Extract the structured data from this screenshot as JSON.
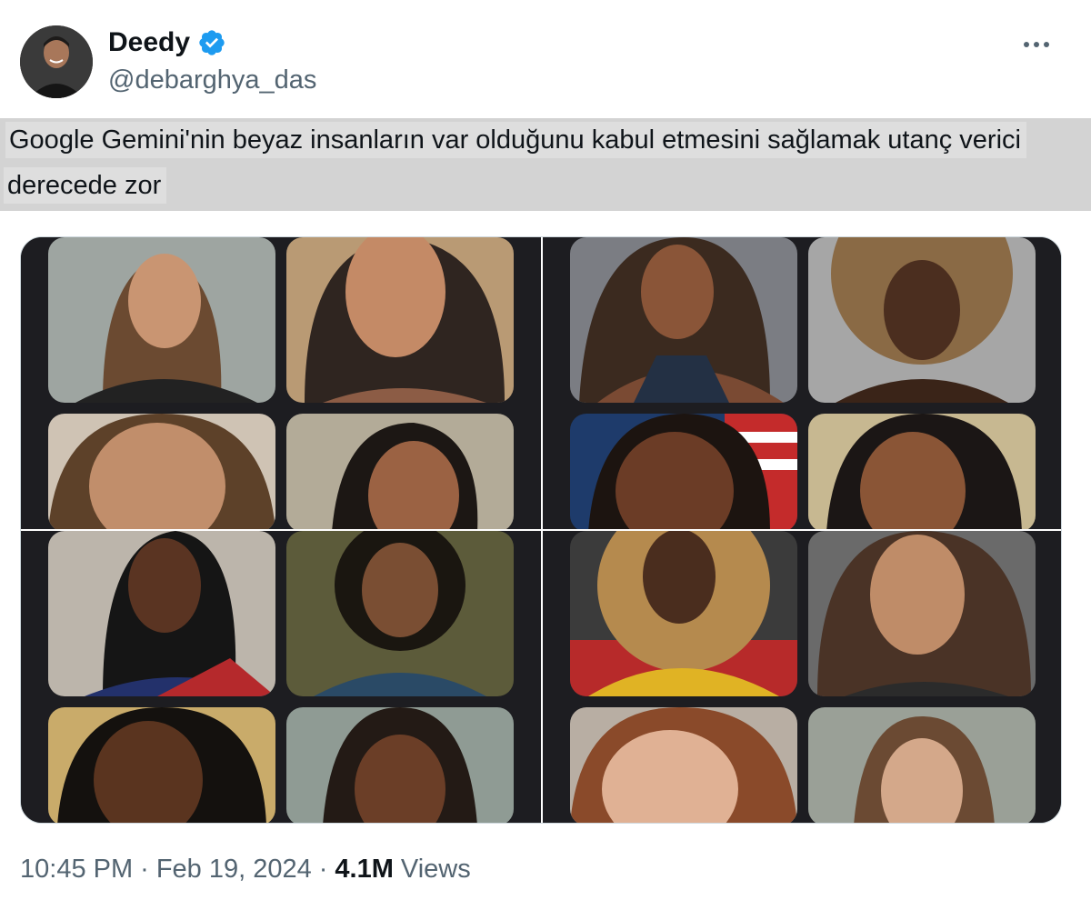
{
  "header": {
    "display_name": "Deedy",
    "handle": "@debarghya_das",
    "verified_icon": "verified-badge-icon",
    "more_icon": "more-horizontal-icon"
  },
  "tweet": {
    "text_line_1": "Google Gemini'nin beyaz insanların var olduğunu kabul etmesini sağlamak utanç verici",
    "text_line_2": "derecede zor"
  },
  "media": {
    "description_icon": "image-grid",
    "quadrants": 4,
    "portraits_per_quadrant": 4
  },
  "footer": {
    "time": "10:45 PM",
    "separator": "·",
    "date": "Feb 19, 2024",
    "views_count": "4.1M",
    "views_label": "Views"
  },
  "colors": {
    "verified": "#1d9bf0",
    "muted_text": "#536471",
    "primary_text": "#0f1419",
    "highlight_bg": "#d3d3d3",
    "media_bg": "#1b1b1e"
  }
}
